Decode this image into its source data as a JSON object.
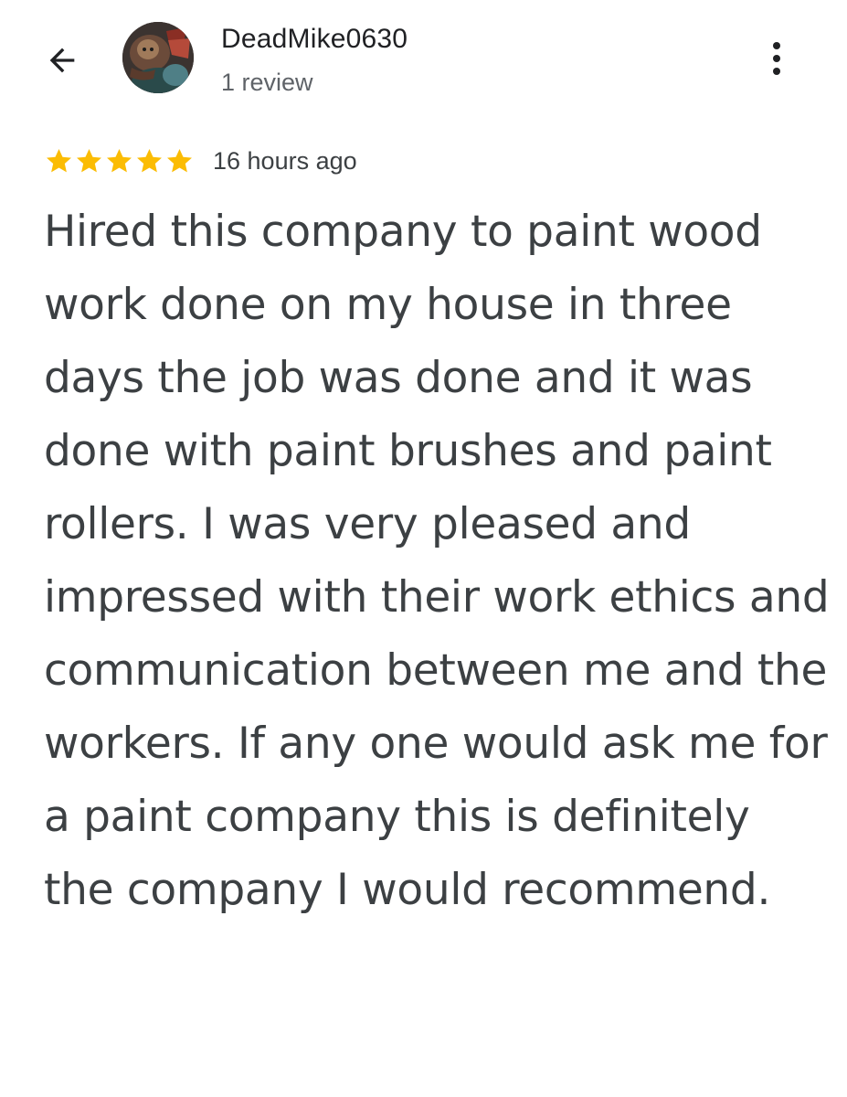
{
  "header": {
    "back_icon": "arrow-left-icon",
    "more_icon": "more-vert-icon"
  },
  "user": {
    "name": "DeadMike0630",
    "review_count": "1 review",
    "avatar_icon": "user-avatar"
  },
  "review": {
    "rating": 5,
    "max_rating": 5,
    "star_color": "#fbbc04",
    "time": "16 hours ago",
    "text": "Hired this company to paint wood work done on my house in three days the job was done and it was done with paint brushes and paint rollers. I was very pleased and impressed with their work ethics and communication between me and the workers. If any one would ask me for a paint company this is definitely the company I would recommend."
  }
}
